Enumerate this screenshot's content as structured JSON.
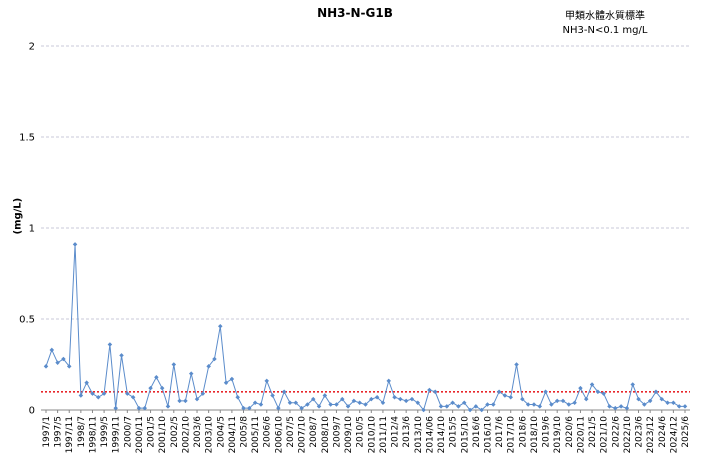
{
  "chart_data": {
    "type": "line",
    "title": "NH3-N-G1B",
    "standard_title": "甲類水體水質標準",
    "standard_text": "NH3-N<0.1 mg/L",
    "xlabel": "",
    "ylabel": "(mg/L)",
    "ylim": [
      0,
      2
    ],
    "yticks": [
      0,
      0.5,
      1,
      1.5,
      2
    ],
    "ytick_labels": [
      "0",
      "0.5",
      "1",
      "1.5",
      "2"
    ],
    "grid": true,
    "standard_value": 0.1,
    "colors": {
      "series": "#5b8ccb",
      "standard": "#e8262b",
      "grid": "#c8c8d8",
      "axis": "#888888"
    },
    "x_tick_labels": [
      "1997/1",
      "1997/5",
      "1997/11",
      "1998/7",
      "1998/11",
      "1999/5",
      "1999/11",
      "2000/7",
      "2000/11",
      "2001/5",
      "2001/10",
      "2002/5",
      "2002/10",
      "2003/6",
      "2003/10",
      "2004/5",
      "2004/11",
      "2005/8",
      "2005/11",
      "2006/6",
      "2006/10",
      "2007/5",
      "2007/10",
      "2008/7",
      "2008/10",
      "2009/7",
      "2009/10",
      "2010/5",
      "2010/10",
      "2011/11",
      "2012/4",
      "2013/6",
      "2013/10",
      "2014/06",
      "2014/10",
      "2015/5",
      "2015/10",
      "2016/6",
      "2016/10",
      "2017/6",
      "2017/10",
      "2018/6",
      "2018/10",
      "2019/6",
      "2019/10",
      "2020/6",
      "2020/11",
      "2021/5",
      "2021/10",
      "2022/6",
      "2022/10",
      "2023/6",
      "2023/12",
      "2024/6",
      "2024/12",
      "2025/6"
    ],
    "series": [
      {
        "name": "",
        "values": [
          0.24,
          0.33,
          0.26,
          0.28,
          0.24,
          0.91,
          0.08,
          0.15,
          0.09,
          0.07,
          0.09,
          0.36,
          0.01,
          0.3,
          0.09,
          0.07,
          0.01,
          0.01,
          0.12,
          0.18,
          0.12,
          0.02,
          0.25,
          0.05,
          0.05,
          0.2,
          0.06,
          0.09,
          0.24,
          0.28,
          0.46,
          0.15,
          0.17,
          0.07,
          0.01,
          0.01,
          0.04,
          0.03,
          0.16,
          0.08,
          0.01,
          0.1,
          0.04,
          0.04,
          0.01,
          0.03,
          0.06,
          0.02,
          0.08,
          0.03,
          0.03,
          0.06,
          0.02,
          0.05,
          0.04,
          0.03,
          0.06,
          0.07,
          0.04,
          0.16,
          0.07,
          0.06,
          0.05,
          0.06,
          0.04,
          0.0,
          0.11,
          0.1,
          0.02,
          0.02,
          0.04,
          0.02,
          0.04,
          0.0,
          0.02,
          0.0,
          0.03,
          0.03,
          0.1,
          0.08,
          0.07,
          0.25,
          0.06,
          0.03,
          0.03,
          0.02,
          0.1,
          0.03,
          0.05,
          0.05,
          0.03,
          0.04,
          0.12,
          0.06,
          0.14,
          0.1,
          0.09,
          0.02,
          0.01,
          0.02,
          0.01,
          0.14,
          0.06,
          0.03,
          0.05,
          0.1,
          0.06,
          0.04,
          0.04,
          0.02,
          0.02
        ]
      }
    ]
  }
}
